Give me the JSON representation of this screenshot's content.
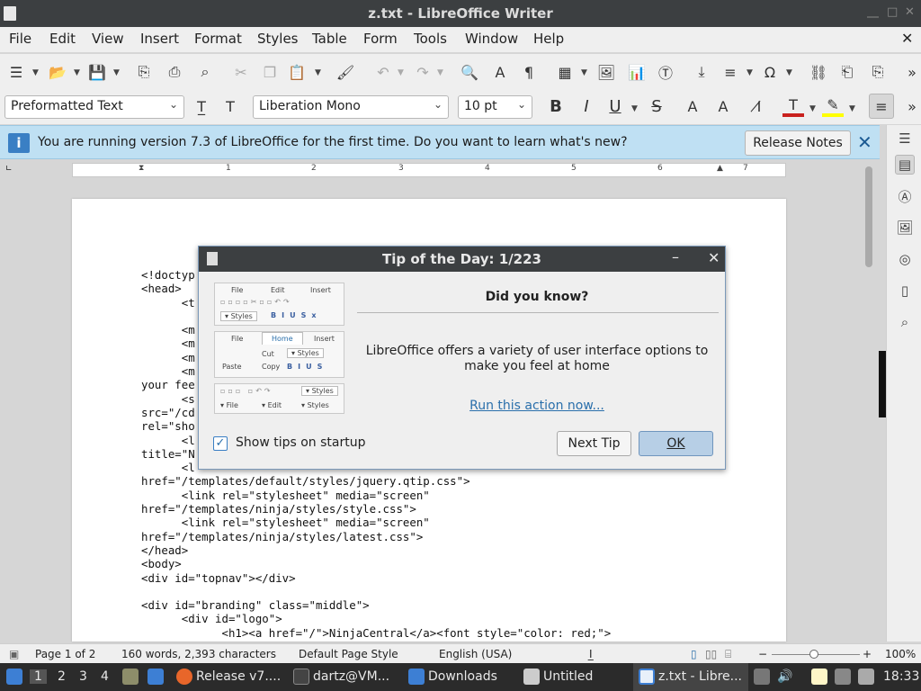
{
  "window": {
    "title": "z.txt - LibreOffice Writer"
  },
  "menu": [
    "File",
    "Edit",
    "View",
    "Insert",
    "Format",
    "Styles",
    "Table",
    "Form",
    "Tools",
    "Window",
    "Help"
  ],
  "formatting": {
    "paragraph_style": "Preformatted Text",
    "font_name": "Liberation Mono",
    "font_size": "10 pt"
  },
  "infobar": {
    "message": "You are running version 7.3 of LibreOffice for the first time. Do you want to learn what's new?",
    "button": "Release Notes"
  },
  "ruler": {
    "numbers": [
      "1",
      "1",
      "2",
      "3",
      "4",
      "5",
      "6",
      "7"
    ]
  },
  "document": {
    "lines": [
      "<!doctyp",
      "<head>",
      "      <t",
      "",
      "      <m",
      "      <m",
      "      <m",
      "      <m",
      "your fee",
      "      <s",
      "src=\"/cd",
      "rel=\"sho",
      "      <l",
      "title=\"N",
      "      <l",
      "href=\"/templates/default/styles/jquery.qtip.css\">",
      "      <link rel=\"stylesheet\" media=\"screen\"",
      "href=\"/templates/ninja/styles/style.css\">",
      "      <link rel=\"stylesheet\" media=\"screen\"",
      "href=\"/templates/ninja/styles/latest.css\">",
      "</head>",
      "<body>",
      "<div id=\"topnav\"></div>",
      "",
      "<div id=\"branding\" class=\"middle\">",
      "      <div id=\"logo\">",
      "            <h1><a href=\"/\">NinjaCentral</a><font style=\"color: red;\">"
    ]
  },
  "dialog": {
    "title": "Tip of the Day: 1/223",
    "heading": "Did you know?",
    "message": "LibreOffice offers a variety of user interface options to make you feel at home",
    "link": "Run this action now...",
    "checkbox_label": "Show tips on startup",
    "checkbox_checked": true,
    "next_button": "Next Tip",
    "ok_button": "OK",
    "image": {
      "mock1": {
        "menu": [
          "File",
          "Edit",
          "Insert"
        ],
        "style": "Styles"
      },
      "mock2": {
        "tabs": [
          "File",
          "Home",
          "Insert"
        ],
        "paste": "Paste",
        "cut": "Cut",
        "copy": "Copy",
        "style": "Styles"
      },
      "mock3": {
        "style": "Styles",
        "file": "File",
        "edit": "Edit",
        "styles2": "Styles"
      }
    }
  },
  "statusbar": {
    "page": "Page 1 of 2",
    "words": "160 words, 2,393 characters",
    "page_style": "Default Page Style",
    "language": "English (USA)",
    "zoom": "100%"
  },
  "taskbar": {
    "workspaces": [
      "1",
      "2",
      "3",
      "4"
    ],
    "apps": [
      "Release v7....",
      "dartz@VM...",
      "Downloads",
      "Untitled",
      "z.txt - Libre..."
    ],
    "time": "18:33"
  },
  "colors": {
    "accent": "#3a7fc4",
    "infobar": "#bfe0f3",
    "titlebar": "#3c3f41",
    "taskbar": "#2b2b2b"
  }
}
